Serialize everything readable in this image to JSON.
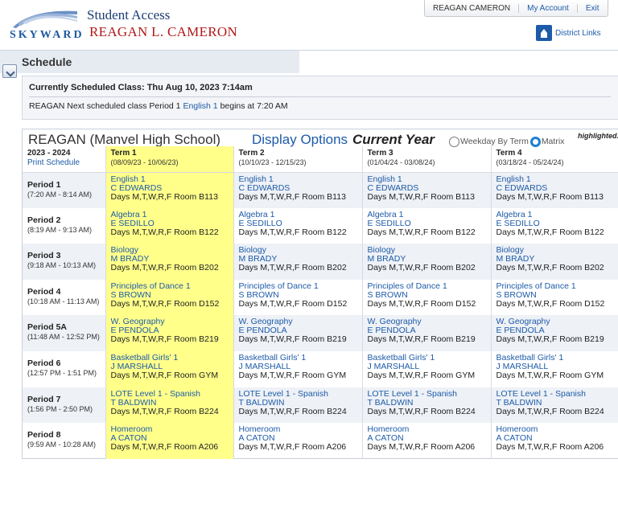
{
  "header": {
    "logo_text": "SKYWARD",
    "app_name": "Student Access",
    "student_name": "REAGAN L. CAMERON",
    "topbar_user": "REAGAN CAMERON",
    "my_account": "My Account",
    "exit": "Exit",
    "district_links": "District Links"
  },
  "page": {
    "title": "Schedule"
  },
  "info": {
    "current_class": "Currently Scheduled Class: Thu Aug 10, 2023 7:14am",
    "next_prefix": "REAGAN Next scheduled class Period 1",
    "next_course": "English 1",
    "next_suffix": "begins at 7:20 AM"
  },
  "grid": {
    "student": "REAGAN   (Manvel High School)",
    "display_options": "Display Options",
    "current_year": "Current Year",
    "option_weekday": "Weekday By Term",
    "option_matrix": "Matrix",
    "note": "highlighted."
  },
  "schedule": {
    "year": "2023 - 2024",
    "print": "Print Schedule",
    "terms": [
      {
        "name": "Term 1",
        "dates": "(08/09/23 - 10/06/23)"
      },
      {
        "name": "Term 2",
        "dates": "(10/10/23 - 12/15/23)"
      },
      {
        "name": "Term 3",
        "dates": "(01/04/24 - 03/08/24)"
      },
      {
        "name": "Term 4",
        "dates": "(03/18/24 - 05/24/24)"
      }
    ],
    "periods": [
      {
        "name": "Period 1",
        "time": "(7:20 AM - 8:14 AM)",
        "course": "English 1",
        "teacher": "C EDWARDS",
        "days": "Days M,T,W,R,F   Room B113"
      },
      {
        "name": "Period 2",
        "time": "(8:19 AM - 9:13 AM)",
        "course": "Algebra 1",
        "teacher": "E SEDILLO",
        "days": "Days M,T,W,R,F   Room B122"
      },
      {
        "name": "Period 3",
        "time": "(9:18 AM - 10:13 AM)",
        "course": "Biology",
        "teacher": "M BRADY",
        "days": "Days M,T,W,R,F   Room B202"
      },
      {
        "name": "Period 4",
        "time": "(10:18 AM - 11:13 AM)",
        "course": "Principles of Dance 1",
        "teacher": "S BROWN",
        "days": "Days M,T,W,R,F   Room D152"
      },
      {
        "name": "Period 5A",
        "time": "(11:48 AM - 12:52 PM)",
        "course": "W. Geography",
        "teacher": "E PENDOLA",
        "days": "Days M,T,W,R,F   Room B219"
      },
      {
        "name": "Period 6",
        "time": "(12:57 PM - 1:51 PM)",
        "course": "Basketball Girls' 1",
        "teacher": "J MARSHALL",
        "days": "Days M,T,W,R,F   Room GYM"
      },
      {
        "name": "Period 7",
        "time": "(1:56 PM - 2:50 PM)",
        "course": "LOTE Level 1 - Spanish",
        "teacher": "T BALDWIN",
        "days": "Days M,T,W,R,F   Room B224"
      },
      {
        "name": "Period 8",
        "time": "(9:59 AM - 10:28 AM)",
        "course": "Homeroom",
        "teacher": "A CATON",
        "days": "Days M,T,W,R,F   Room A206"
      }
    ]
  }
}
